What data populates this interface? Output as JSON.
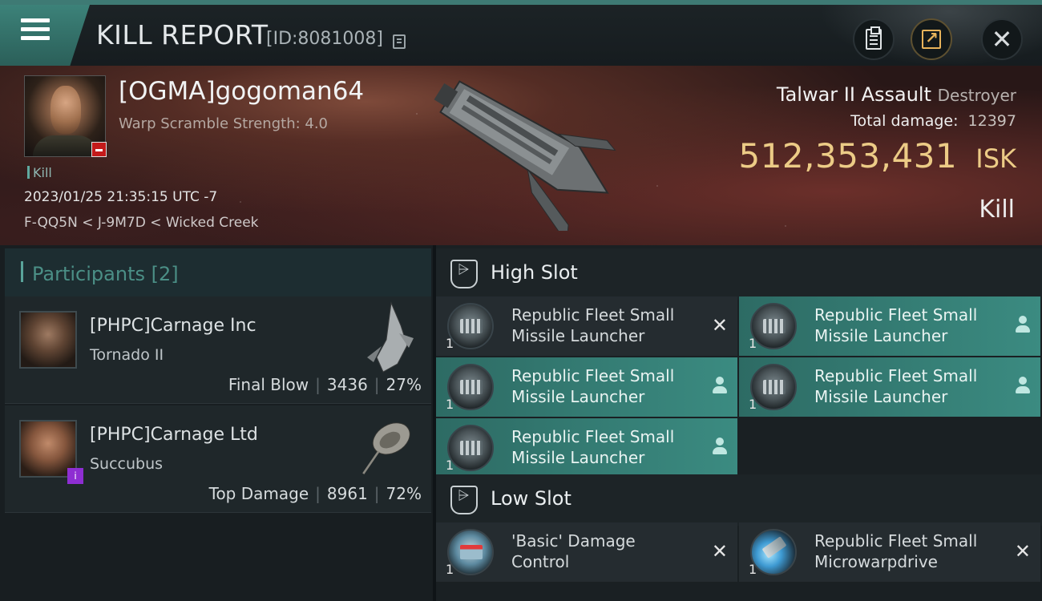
{
  "header": {
    "title": "KILL REPORT",
    "report_id": "[ID:8081008]"
  },
  "victim": {
    "name": "[OGMA]gogoman64",
    "scramble": "Warp Scramble Strength: 4.0",
    "tag": "Kill",
    "timestamp": "2023/01/25 21:35:15 UTC -7",
    "location": "F-QQ5N < J-9M7D < Wicked Creek",
    "ship_name": "Talwar II Assault",
    "ship_class": "Destroyer",
    "total_damage_label": "Total damage:",
    "total_damage": "12397",
    "isk_value": "512,353,431",
    "isk_unit": "ISK",
    "result": "Kill"
  },
  "participants": {
    "title": "Participants [2]",
    "items": [
      {
        "name": "[PHPC]Carnage Inc",
        "ship": "Tornado II",
        "role": "Final Blow",
        "damage": "3436",
        "percent": "27%"
      },
      {
        "name": "[PHPC]Carnage Ltd",
        "ship": "Succubus",
        "role": "Top Damage",
        "damage": "8961",
        "percent": "72%"
      }
    ]
  },
  "fitting": {
    "high_slot_label": "High Slot",
    "low_slot_label": "Low Slot",
    "high_slot": [
      {
        "name": "Republic Fleet Small Missile Launcher",
        "qty": "1",
        "state": "destroyed"
      },
      {
        "name": "Republic Fleet Small Missile Launcher",
        "qty": "1",
        "state": "dropped"
      },
      {
        "name": "Republic Fleet Small Missile Launcher",
        "qty": "1",
        "state": "dropped"
      },
      {
        "name": "Republic Fleet Small Missile Launcher",
        "qty": "1",
        "state": "dropped"
      },
      {
        "name": "Republic Fleet Small Missile Launcher",
        "qty": "1",
        "state": "dropped"
      }
    ],
    "low_slot": [
      {
        "name": "'Basic' Damage Control",
        "qty": "1",
        "state": "destroyed"
      },
      {
        "name": "Republic Fleet Small Microwarpdrive",
        "qty": "1",
        "state": "destroyed"
      }
    ]
  },
  "colors": {
    "accent": "#3b8b81",
    "isk": "#eccb86",
    "negative_standing": "#c41a1a"
  }
}
